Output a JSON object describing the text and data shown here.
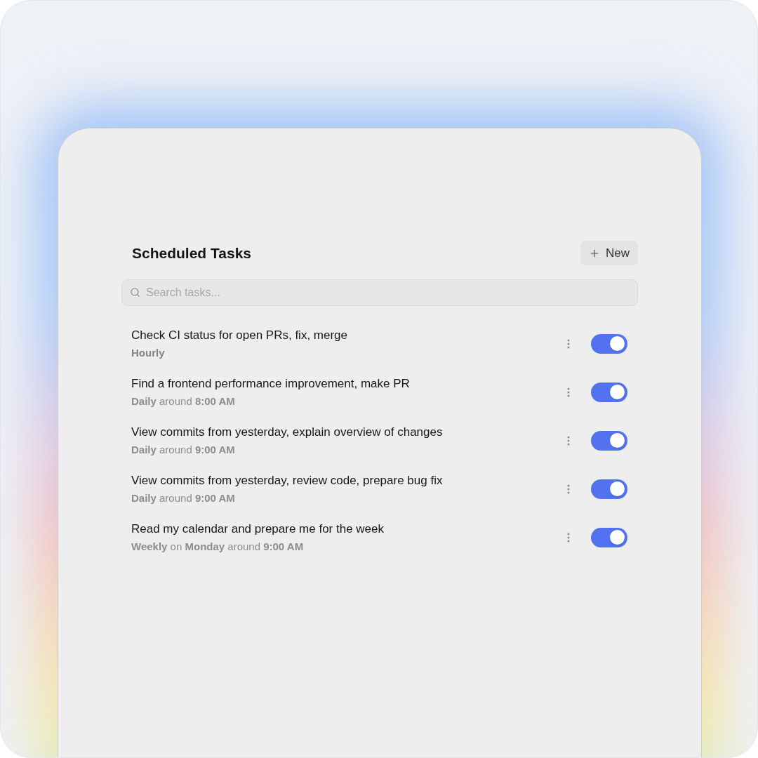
{
  "title": "Scheduled Tasks",
  "new_button": {
    "label": "New"
  },
  "search": {
    "placeholder": "Search tasks..."
  },
  "tasks": [
    {
      "title": "Check CI status for open PRs, fix, merge",
      "schedule": "Hourly",
      "schedule_bold": true,
      "on": true
    },
    {
      "title": "Find a frontend performance improvement, make PR",
      "schedule": "**Daily** around **8:00 AM**",
      "schedule_bold": false,
      "on": true
    },
    {
      "title": "View commits from yesterday, explain overview of changes",
      "schedule": "**Daily** around **9:00 AM**",
      "schedule_bold": false,
      "on": true
    },
    {
      "title": "View commits from yesterday, review code, prepare bug fix",
      "schedule": "**Daily** around **9:00 AM**",
      "schedule_bold": false,
      "on": true
    },
    {
      "title": "Read my calendar and prepare me for the week",
      "schedule": "**Weekly** on **Monday** around **9:00 AM**",
      "schedule_bold": false,
      "on": true
    }
  ]
}
